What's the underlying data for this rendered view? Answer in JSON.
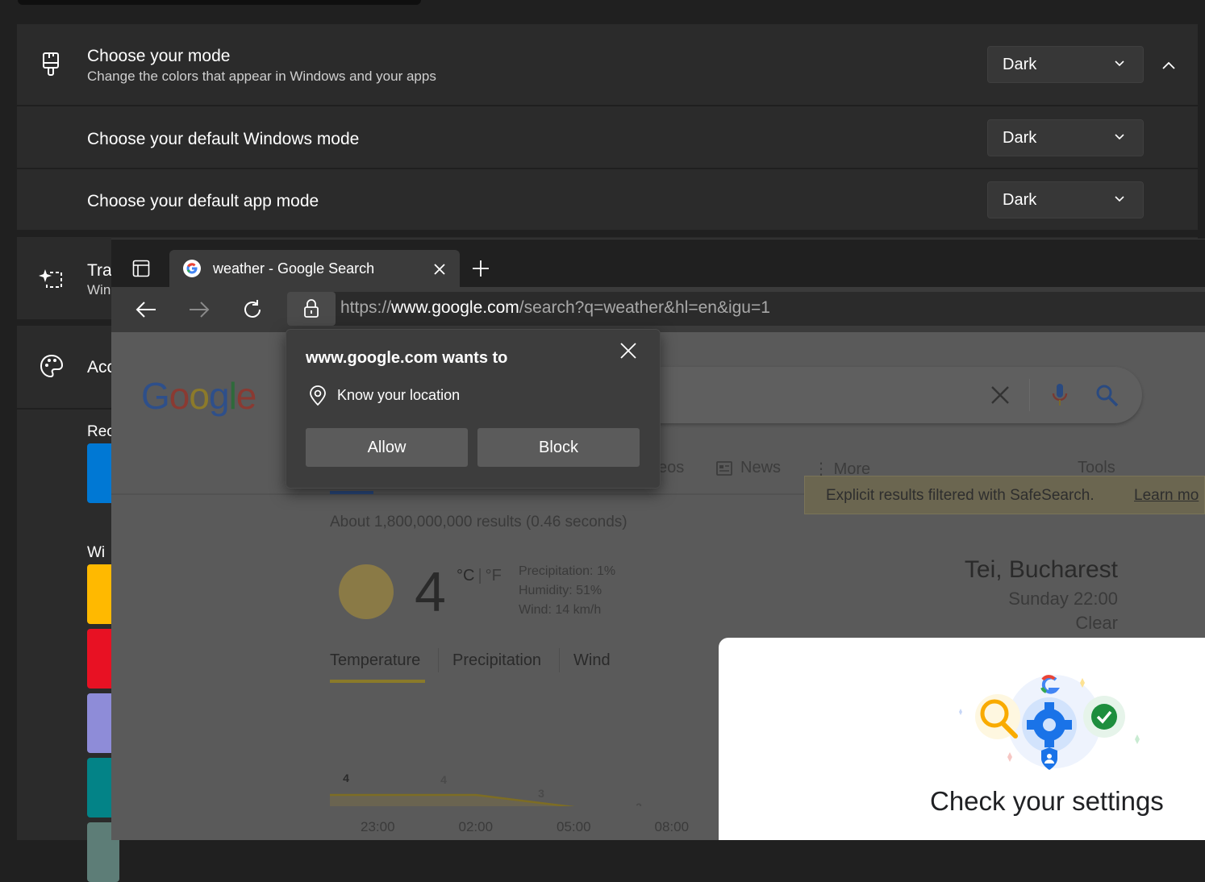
{
  "settings": {
    "mode_title": "Choose your mode",
    "mode_sub": "Change the colors that appear in Windows and your apps",
    "mode_value": "Dark",
    "windows_mode_title": "Choose your default Windows mode",
    "windows_mode_value": "Dark",
    "app_mode_title": "Choose your default app mode",
    "app_mode_value": "Dark",
    "transparency_title": "Tra",
    "transparency_sub": "Win",
    "accent_title": "Acc",
    "recent_label": "Rec",
    "windows_colors_label": "Wi"
  },
  "browser": {
    "tab_title": "weather - Google Search",
    "url_scheme": "https://",
    "url_host": "www.google.com",
    "url_path": "/search?q=weather&hl=en&igu=1"
  },
  "permission": {
    "title": "www.google.com wants to",
    "item": "Know your location",
    "allow": "Allow",
    "block": "Block"
  },
  "google": {
    "logo": "Google",
    "tab_videos_partial": "eos",
    "tab_news": "News",
    "tab_more": "More",
    "tools": "Tools",
    "safesearch": "Explicit results filtered with SafeSearch.",
    "learn_more": "Learn mo",
    "results_count": "About 1,800,000,000 results (0.46 seconds)",
    "weather": {
      "temp": "4",
      "unit_c": "°C",
      "unit_sep": "|",
      "unit_f": "°F",
      "precipitation": "Precipitation: 1%",
      "humidity": "Humidity: 51%",
      "wind": "Wind: 14 km/h",
      "location": "Tei, Bucharest",
      "time": "Sunday 22:00",
      "condition": "Clear",
      "tab_temperature": "Temperature",
      "tab_precipitation": "Precipitation",
      "tab_wind": "Wind"
    },
    "check_settings": "Check your settings"
  },
  "chart_data": {
    "type": "area",
    "categories": [
      "23:00",
      "02:00",
      "05:00",
      "08:00"
    ],
    "values": [
      4,
      4,
      3,
      2
    ],
    "ylim": [
      0,
      10
    ]
  },
  "colors": {
    "swatches": [
      "#0078d4",
      "#ffb900",
      "#e81123",
      "#8e8cd8",
      "#038387",
      "#5d7d77"
    ]
  }
}
